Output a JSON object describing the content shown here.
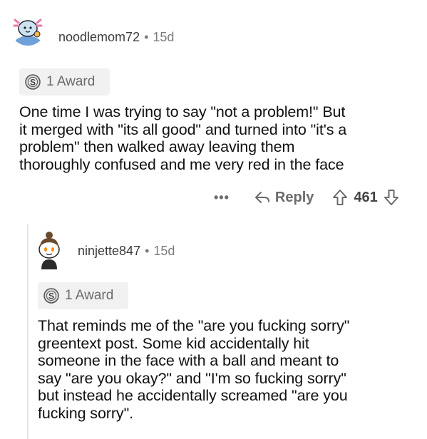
{
  "comments": [
    {
      "username": "noodlemom72",
      "separator": "•",
      "age": "15d",
      "award": "1 Award",
      "body_lines": [
        "One time I was trying to say \"not a problem!\" But",
        "it merged with \"its all good\" and turned into \"it's a",
        "problem\" then walked away leaving them",
        "thoroughly  confused and me very red in the face"
      ],
      "more": "•••",
      "reply": "Reply",
      "score": "461"
    },
    {
      "username": "ninjette847",
      "separator": "•",
      "age": "15d",
      "award": "1 Award",
      "body_lines": [
        "That reminds me of the \"are you fucking sorry\"",
        "greentext post.  Some kid accidentally hit",
        "someone in the face with a ball and meant to",
        "say \"are you okay?\" and \"I'm so fucking sorry\"",
        "but instead he accidentally screamed \"are you",
        "fucking sorry\"."
      ]
    }
  ],
  "icons": {
    "award": "silver-award-icon",
    "reply": "reply-arrow-icon",
    "upvote": "upvote-arrow-icon",
    "downvote": "downvote-arrow-icon"
  },
  "colors": {
    "avatar1_bg": "#4a78b8",
    "award_bg": "#f1f1f1",
    "meta": "#7c7c7c"
  }
}
